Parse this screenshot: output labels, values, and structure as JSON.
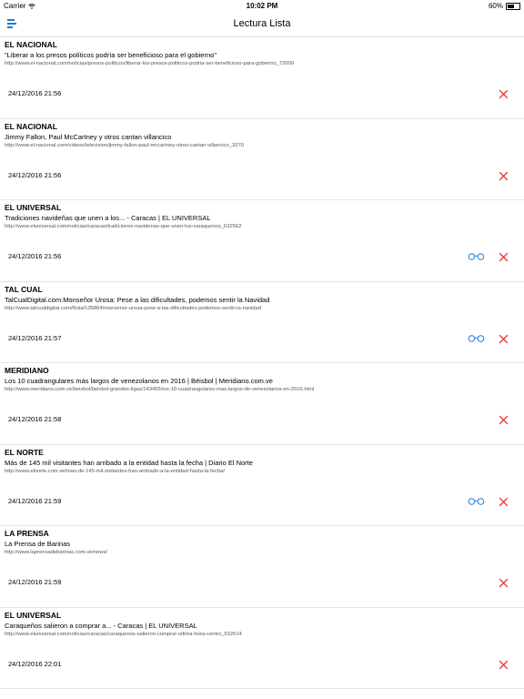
{
  "status": {
    "carrier": "Carrier",
    "time": "10:02 PM",
    "battery": "60%",
    "battery_level": 0.6
  },
  "nav": {
    "title": "Lectura Lista"
  },
  "items": [
    {
      "source": "EL NACIONAL",
      "headline": "\"Liberar a los presos políticos podría ser beneficioso para el gobierno\"",
      "url": "http://www.el-nacional.com/noticias/presos-politicos/liberar-los-presos-politicos-podria-ser-beneficioso-para-gobierno_72600",
      "date": "24/12/2016 21:56",
      "read": false
    },
    {
      "source": "EL NACIONAL",
      "headline": "Jimmy Fallon, Paul McCartney y otros cantan villancico",
      "url": "http://www.el-nacional.com/videos/television/jimmy-fallon-paul-mccartney-otros-cantan-villancico_3270",
      "date": "24/12/2016 21:56",
      "read": false
    },
    {
      "source": "EL UNIVERSAL",
      "headline": "Tradiciones navideñas que unen a los... - Caracas | EL UNIVERSAL",
      "url": "http://www.eluniversal.com/noticias/caracas/tradiciones-navidenas-que-unen-los-caraquenos_632562",
      "date": "24/12/2016 21:56",
      "read": true
    },
    {
      "source": "TAL CUAL",
      "headline": "TalCualDigital.com:Monseñor Urosa: Pese a las dificultades, podemos sentir la Navidad",
      "url": "http://www.talcualdigital.com/Nota/135864/monsenor-urosa-pese-a-las-dificultades-podemos-sentir-la-navidad",
      "date": "24/12/2016 21:57",
      "read": true
    },
    {
      "source": "MERIDIANO",
      "headline": "Los 10 cuadrangulares más largos de venezolanos en 2016 | Béisbol | Meridiano.com.ve",
      "url": "http://www.meridiano.com.ve/beisbol/beisbol-grandes-ligas/143455/los-10-cuadrangulares-mas-largos-de-venezolanos-en-2016.html",
      "date": "24/12/2016 21:58",
      "read": false
    },
    {
      "source": "EL NORTE",
      "headline": "Más de 145 mil visitantes han arribado a la entidad hasta la fecha | Diario El Norte",
      "url": "http://www.elnorte.com.ve/mas-de-145-mil-visitantes-han-arribado-a-la-entidad-hasta-la-fecha/",
      "date": "24/12/2016 21:59",
      "read": true
    },
    {
      "source": "LA PRENSA",
      "headline": "La Prensa de Barinas",
      "url": "http://www.laprensadebarinas.com.ve/news/",
      "date": "24/12/2016 21:59",
      "read": false
    },
    {
      "source": "EL UNIVERSAL",
      "headline": "Caraqueños salieron a comprar a... - Caracas | EL UNIVERSAL",
      "url": "http://www.eluniversal.com/noticias/caracas/caraquenos-salieron-comprar-ultima-hora-centro_632614",
      "date": "24/12/2016 22:01",
      "read": false
    }
  ],
  "colors": {
    "accent": "#1a7bd6",
    "delete": "#e53935",
    "divider": "#e6e6e6"
  },
  "icons": {
    "menu": "menu-icon",
    "read": "glasses-icon",
    "delete": "close-icon"
  }
}
